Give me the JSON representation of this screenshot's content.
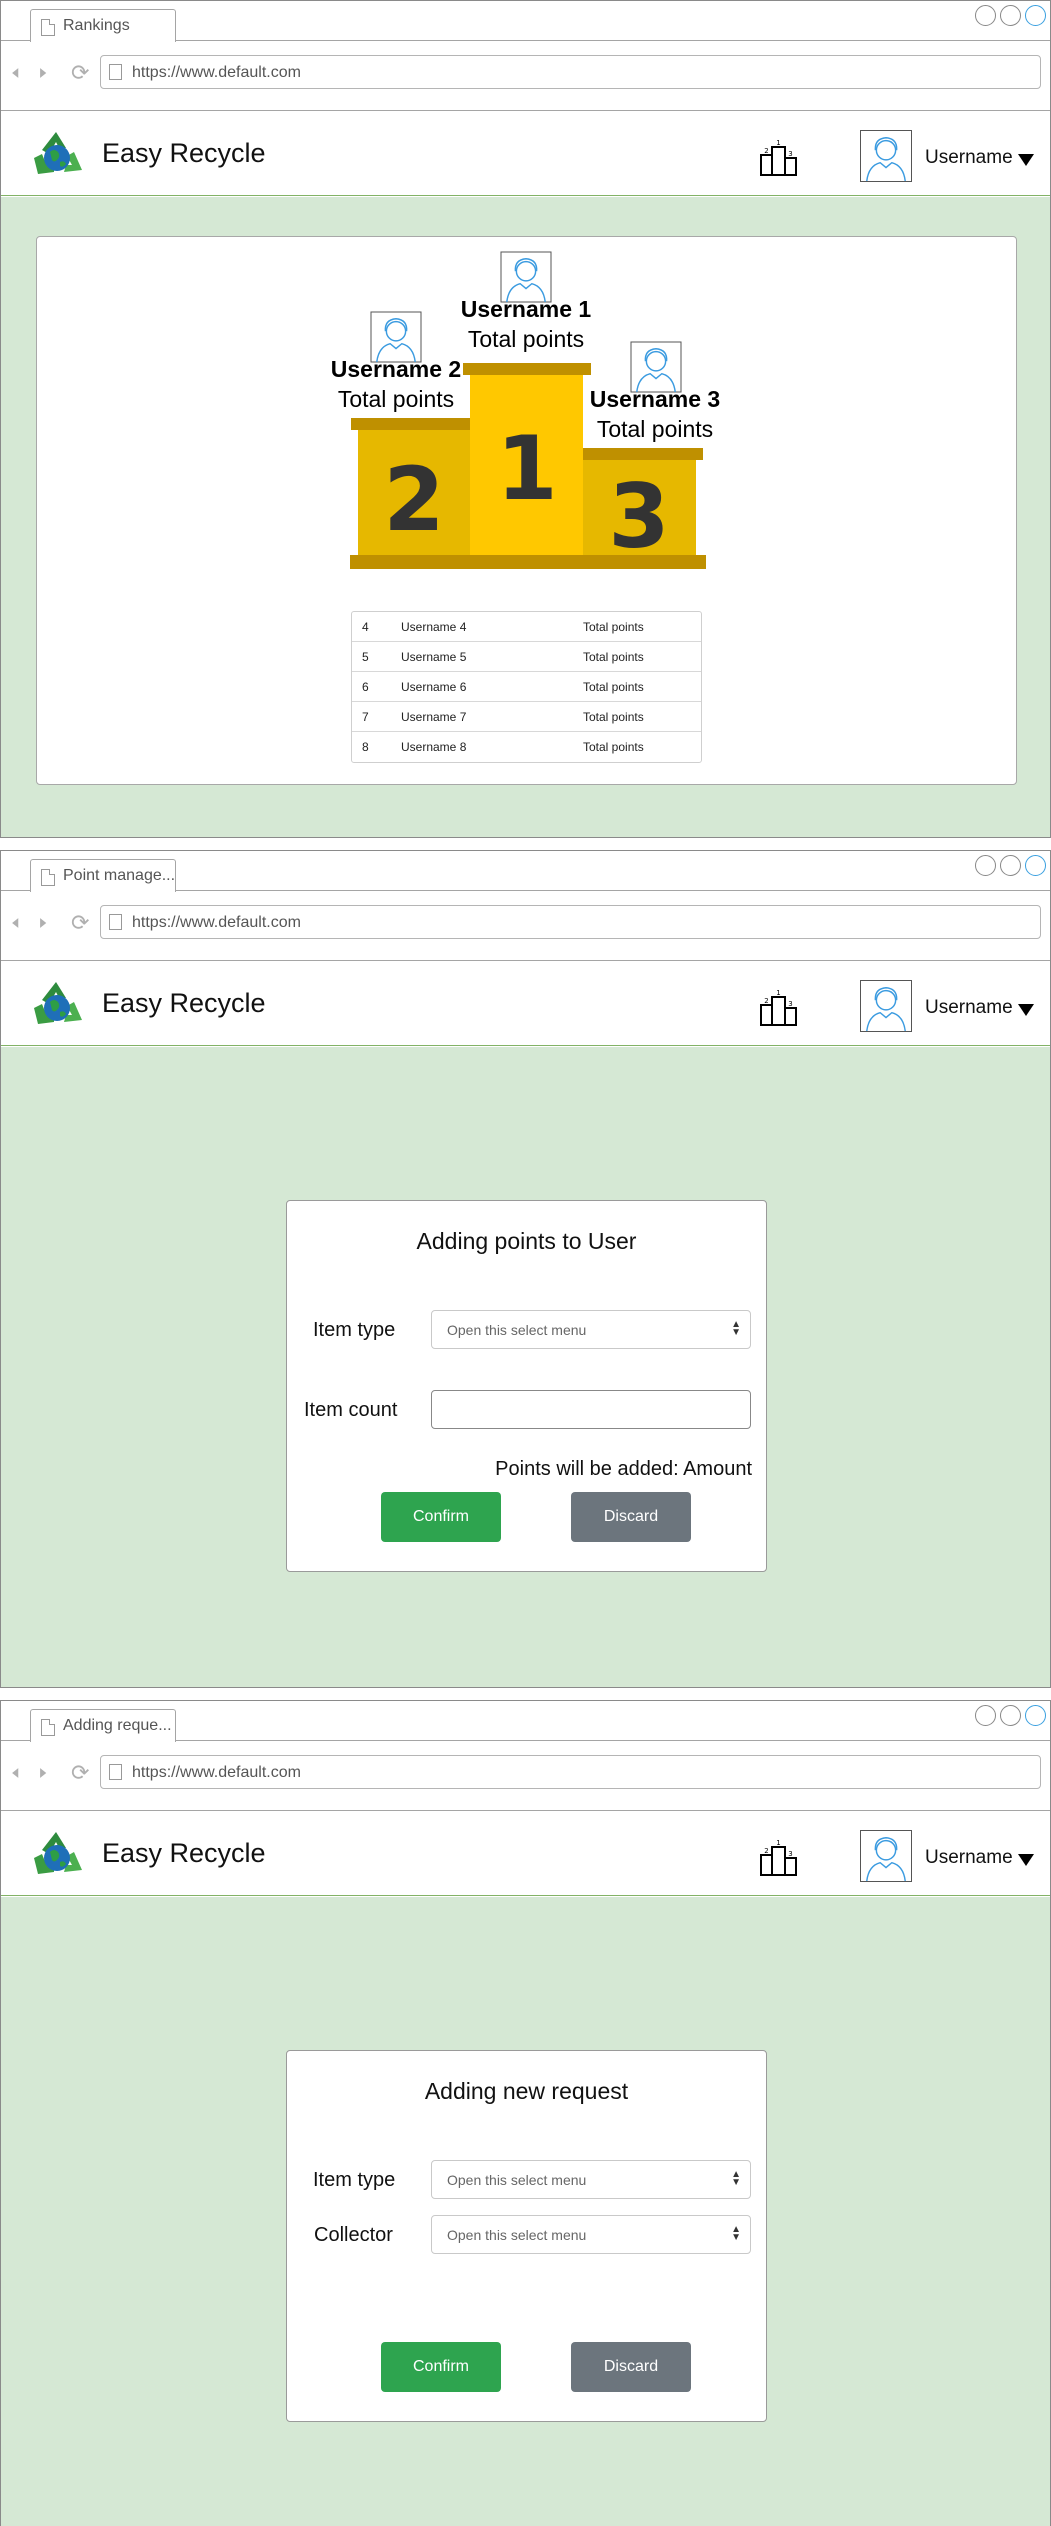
{
  "common": {
    "url": "https://www.default.com",
    "brand": "Easy Recycle",
    "username": "Username"
  },
  "colors": {
    "page_green": "#d5e8d4",
    "confirm_green": "#2ea44f",
    "discard_grey": "#6c757d",
    "podium_gold": "#ffc800",
    "podium_dark_gold": "#bf9000"
  },
  "icons": [
    "page-icon",
    "back-arrow-icon",
    "forward-arrow-icon",
    "reload-icon",
    "recycle-globe-logo-icon",
    "podium-rankings-icon",
    "user-avatar-icon",
    "caret-down-icon",
    "select-arrows-icon"
  ],
  "window1": {
    "tab": "Rankings",
    "podium": {
      "first": {
        "rank": "1",
        "name": "Username 1",
        "points": "Total points"
      },
      "second": {
        "rank": "2",
        "name": "Username 2",
        "points": "Total points"
      },
      "third": {
        "rank": "3",
        "name": "Username 3",
        "points": "Total points"
      }
    },
    "table": [
      {
        "rank": "4",
        "name": "Username 4",
        "points": "Total points"
      },
      {
        "rank": "5",
        "name": "Username 5",
        "points": "Total points"
      },
      {
        "rank": "6",
        "name": "Username 6",
        "points": "Total points"
      },
      {
        "rank": "7",
        "name": "Username 7",
        "points": "Total points"
      },
      {
        "rank": "8",
        "name": "Username 8",
        "points": "Total points"
      }
    ]
  },
  "window2": {
    "tab": "Point manage...",
    "title": "Adding points to User",
    "item_type_label": "Item type",
    "item_type_select": "Open this select menu",
    "item_count_label": "Item count",
    "item_count_value": "",
    "note": "Points will be added: Amount",
    "confirm": "Confirm",
    "discard": "Discard"
  },
  "window3": {
    "tab": "Adding reque...",
    "title": "Adding new request",
    "item_type_label": "Item type",
    "item_type_select": "Open this select menu",
    "collector_label": "Collector",
    "collector_select": "Open this select menu",
    "confirm": "Confirm",
    "discard": "Discard"
  }
}
